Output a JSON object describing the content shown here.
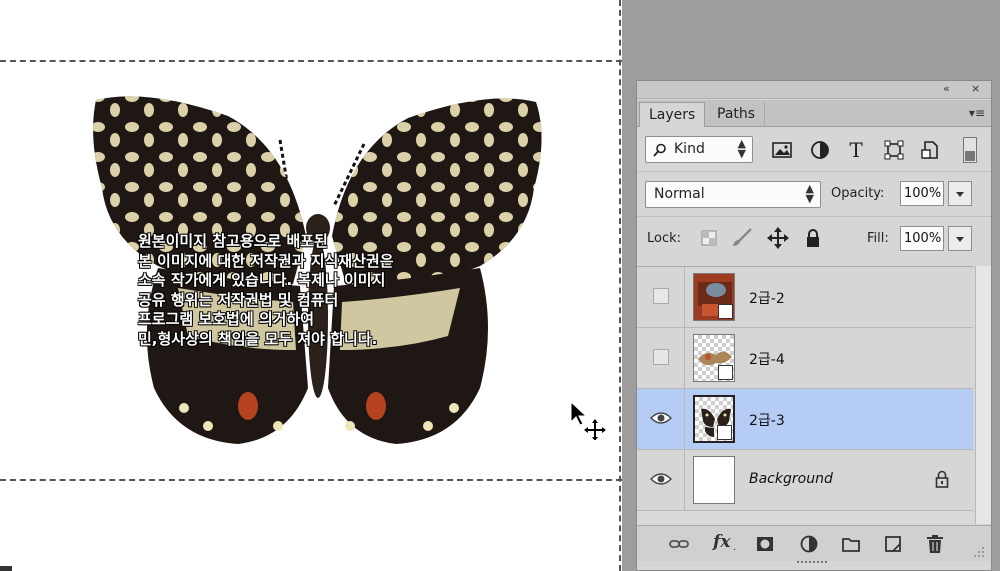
{
  "canvas": {
    "watermark_lines": [
      "원본이미지 참고용으로 배포된",
      "본 이미지에 대한 저작권과 지식재산권은",
      "소속 작가에게 있습니다. 복제나 이미지",
      "공유 행위는 저작권법 및 컴퓨터",
      "프로그램 보호법에 의거하여",
      "민,형사상의 책임을 모두 져야 합니다."
    ]
  },
  "panel": {
    "collapse_glyph": "«",
    "close_glyph": "×",
    "tabs": [
      {
        "label": "Layers",
        "active": true
      },
      {
        "label": "Paths",
        "active": false
      }
    ],
    "menu_glyph": "▾≡",
    "filter": {
      "kind_label": "Kind",
      "icons": [
        "image-filter-icon",
        "adjustment-filter-icon",
        "type-filter-icon",
        "shape-filter-icon",
        "smart-object-filter-icon"
      ]
    },
    "blend_mode": "Normal",
    "opacity_label": "Opacity:",
    "opacity_value": "100%",
    "lock_label": "Lock:",
    "fill_label": "Fill:",
    "fill_value": "100%",
    "layers": [
      {
        "name": "2급-2",
        "visible": false,
        "selected": false
      },
      {
        "name": "2급-4",
        "visible": false,
        "selected": false
      },
      {
        "name": "2급-3",
        "visible": true,
        "selected": true
      },
      {
        "name": "Background",
        "visible": true,
        "selected": false,
        "locked": true
      }
    ],
    "bottom_icons": [
      "link-layers-icon",
      "fx-icon",
      "add-mask-icon",
      "adjustment-layer-icon",
      "new-group-icon",
      "new-layer-icon",
      "delete-layer-icon"
    ],
    "fx_label": "fx",
    "selection_color": "#b5ccf5"
  }
}
